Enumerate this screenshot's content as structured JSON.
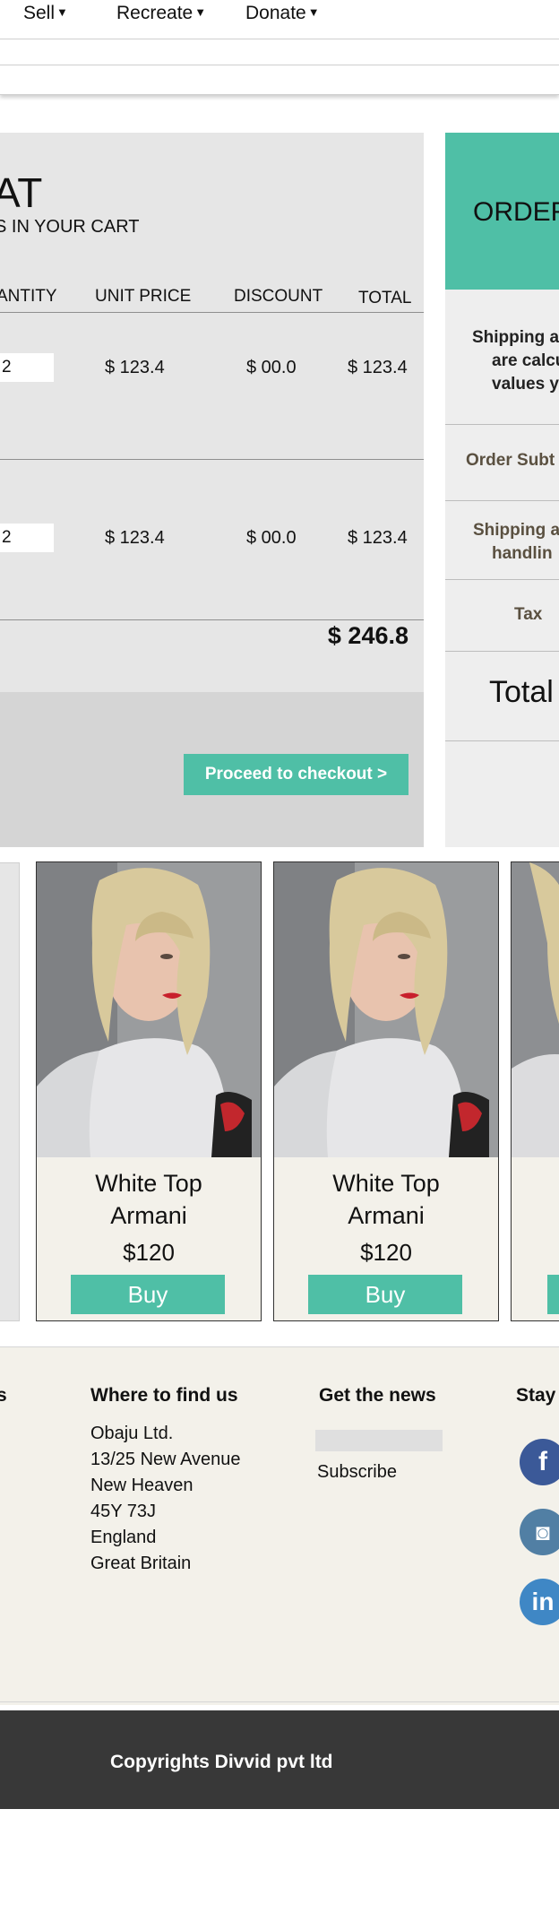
{
  "nav": {
    "items": [
      {
        "label": "Sell"
      },
      {
        "label": "Recreate"
      },
      {
        "label": "Donate"
      }
    ]
  },
  "cart": {
    "title": "AT",
    "subtitle": "S IN YOUR CART",
    "columns": [
      "ANTITY",
      "UNIT PRICE",
      "DISCOUNT",
      "TOTAL"
    ],
    "rows": [
      {
        "qty": "2",
        "unit_price": "$ 123.4",
        "discount": "$ 00.0",
        "total": "$ 123.4"
      },
      {
        "qty": "2",
        "unit_price": "$ 123.4",
        "discount": "$ 00.0",
        "total": "$ 123.4"
      }
    ],
    "grand_total": "$ 246.8",
    "checkout_label": "Proceed to checkout >"
  },
  "order": {
    "title": "ORDER",
    "note_lines": [
      "Shipping a",
      "are calcul",
      "values y"
    ],
    "subtotal_label": "Order Subt",
    "shipping_lines": [
      "Shipping a",
      "handlin"
    ],
    "tax_label": "Tax",
    "total_label": "Total"
  },
  "products": [
    {
      "name_lines": [
        "White Top",
        "Armani"
      ],
      "price": "$120",
      "buy_label": "Buy"
    },
    {
      "name_lines": [
        "White Top",
        "Armani"
      ],
      "price": "$120",
      "buy_label": "Buy"
    }
  ],
  "footer": {
    "left_heading": "s",
    "find_heading": "Where to find us",
    "address_lines": [
      "Obaju Ltd.",
      "13/25 New Avenue",
      "New Heaven",
      "45Y 73J",
      "England",
      "Great Britain"
    ],
    "news_heading": "Get the news",
    "subscribe_label": "Subscribe",
    "stay_heading": "Stay",
    "social": [
      {
        "icon": "facebook-icon",
        "glyph": "f",
        "color": "#3b5998"
      },
      {
        "icon": "instagram-icon",
        "glyph": "◙",
        "color": "#517fa4"
      },
      {
        "icon": "linkedin-icon",
        "glyph": "in",
        "color": "#3f87c5"
      }
    ],
    "copyright": "Copyrights Divvid pvt ltd"
  },
  "colors": {
    "accent": "#4fbfa6",
    "cart_bg": "#e6e6e6",
    "footer_bg": "#f3f1ea",
    "copyright_bg": "#383838"
  }
}
